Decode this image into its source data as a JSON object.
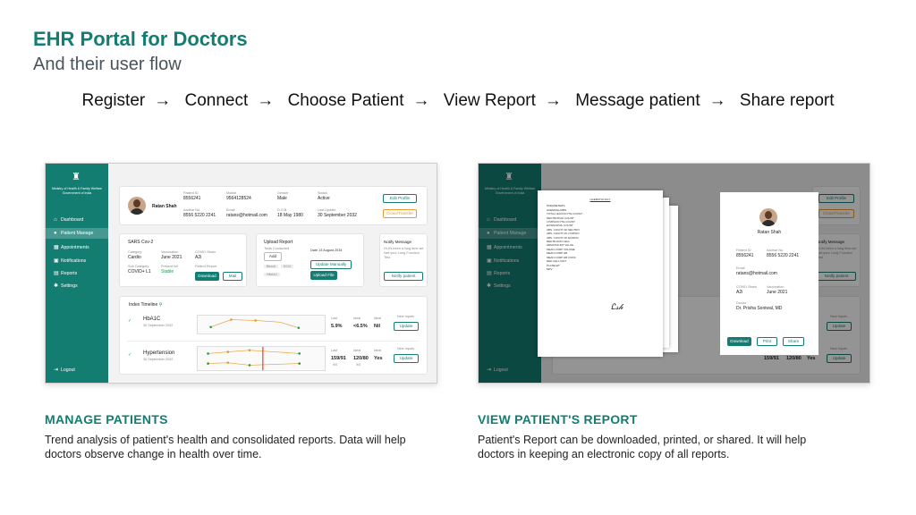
{
  "header": {
    "title": "EHR Portal for Doctors",
    "subtitle": "And their user flow"
  },
  "flow": {
    "steps": [
      "Register",
      "Connect",
      "Choose Patient",
      "View Report",
      "Message patient",
      "Share report"
    ],
    "arrow": "→"
  },
  "sidebar": {
    "ministry": "Ministry of Health & Family Welfare Government of India",
    "items": [
      {
        "label": "Dashboard",
        "icon": "home-icon"
      },
      {
        "label": "Patient Manage",
        "icon": "user-icon"
      },
      {
        "label": "Appointments",
        "icon": "calendar-icon"
      },
      {
        "label": "Notifications",
        "icon": "bell-icon"
      },
      {
        "label": "Reports",
        "icon": "report-icon"
      },
      {
        "label": "Settings",
        "icon": "gear-icon"
      }
    ],
    "logout": "Logout"
  },
  "patient": {
    "name": "Ratan Shah",
    "id_label": "Patient ID",
    "id": "8556241",
    "aadhar_label": "Aadhar No.",
    "aadhar": "8556 5220 2241",
    "mobile_label": "Mobile",
    "mobile": "9564128524",
    "email_label": "Email",
    "email": "ratans@hotmail.com",
    "gender_label": "Gender",
    "gender": "Male",
    "dob_label": "D.O.B",
    "dob": "18 May 1980",
    "status_label": "Status",
    "status": "Active",
    "last_update_label": "Last Update",
    "last_update": "30 September 2032",
    "edit_btn": "Edit Profile",
    "close_btn": "Close/Transfer"
  },
  "covid": {
    "title": "SARS Cov-2",
    "category_label": "Category",
    "category": "Cardio",
    "vaccination_label": "Vaccination",
    "vaccination": "June 2021",
    "strain_label": "COVID Strain",
    "strain": "A2i",
    "subcat_label": "Sub Category",
    "subcat": "COVID+ L1",
    "present_label": "Present Wt",
    "present": "Stable",
    "report_label": "Patient Report",
    "download_btn": "Download",
    "mail_btn": "Mail"
  },
  "upload": {
    "title": "Upload Report",
    "tests_label": "Tests Conducted",
    "add": "Add",
    "date_label": "Date",
    "date": "13 August 2034",
    "tags": [
      "Blood",
      "ECG",
      "HbA1C"
    ],
    "manual_btn": "Update Manually",
    "file_btn": "Upload File"
  },
  "notify": {
    "title": "Notify Message",
    "text": "Hi,It's been a long time we had your Lung Function Test",
    "btn": "Notify patient"
  },
  "timeline": {
    "title": "Index Timeline",
    "rows": [
      {
        "name": "HbA1C",
        "date": "30 September 2032",
        "last_label": "Last",
        "last": "5.9%",
        "ideal_label": "Ideal",
        "ideal": "<6.5%",
        "ideal2_label": "Ideal",
        "ideal2": "Nil",
        "new_label": "New Inputs",
        "btn": "Update"
      },
      {
        "name": "Hypertension",
        "date": "30 September 2032",
        "last_label": "Last",
        "last": "159/91",
        "last_sub": "9/0",
        "ideal_label": "Ideal",
        "ideal": "120/80",
        "ideal_sub": "9/0",
        "ideal2_label": "Ideal",
        "ideal2": "Yes",
        "new_label": "New Inputs",
        "btn": "Update"
      }
    ]
  },
  "report": {
    "doc_title": "HAEMATOLOGY",
    "patient_label": "Patient ID",
    "aadhar_label": "Aadhar No.",
    "email_label": "Email",
    "vacc_label": "Vaccination",
    "strain_label": "COVID Strain",
    "doctor_label": "Doctor",
    "doctor": "Dr. Prisha Soniwal, MD",
    "download_btn": "Download",
    "print_btn": "Print",
    "share_btn": "Share",
    "lines": [
      "PARAMETERS",
      "HAEMOGLOBIN",
      "TOTAL LEUCOCYTE COUNT",
      "NEUTROPHIL COUNT",
      "LYMPHOCYTE COUNT",
      "EOSINOPHIL COUNT",
      "ABS. COUNT OF NEUTRO",
      "ABS. COUNT OF LYMPHO",
      "ABS. COUNT OF EOSINO",
      "RED BLOOD CELL",
      "HEMATOCRIT VALUE",
      "MEAN CORP VOLUME",
      "MEAN CORP HB",
      "MEAN CORP HB CONC",
      "RED CELL DIST",
      "PLATELET",
      "MPV"
    ]
  },
  "sections": [
    {
      "heading": "MANAGE PATIENTS",
      "text": "Trend analysis of patient's health and consolidated reports. Data will help doctors observe change in health over time."
    },
    {
      "heading": "VIEW PATIENT'S REPORT",
      "text": "Patient's Report can be downloaded, printed, or shared. It will help doctors in keeping an electronic copy of all reports."
    }
  ],
  "colors": {
    "brand": "#137d72",
    "accent": "#e89a2c",
    "positive": "#1a9c4b",
    "alert": "#e0322b"
  }
}
